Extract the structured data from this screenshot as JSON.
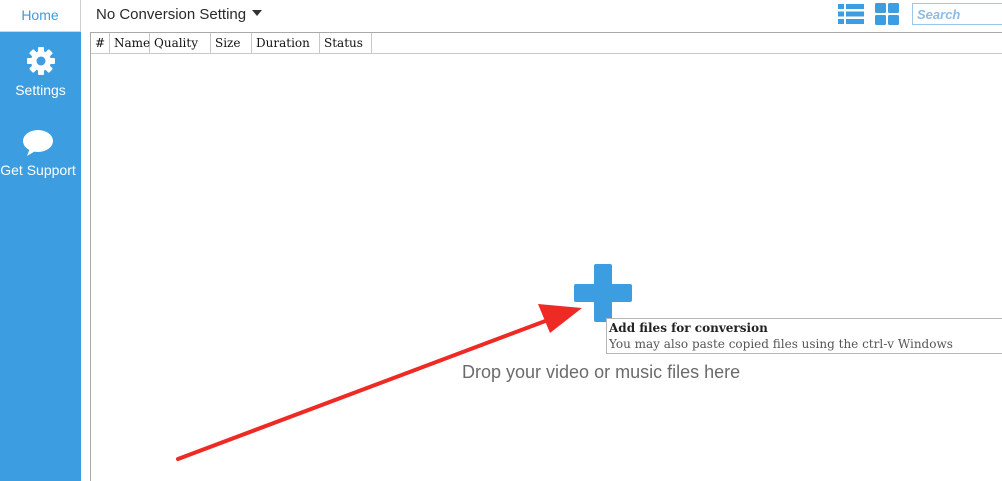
{
  "sidebar": {
    "home_label": "Home",
    "items": [
      {
        "label": "Settings",
        "icon": "gear-icon"
      },
      {
        "label": "Get Support",
        "icon": "speech-bubble-icon"
      }
    ]
  },
  "toolbar": {
    "conversion_setting": "No Conversion Setting",
    "search_placeholder": "Search",
    "view_icons": [
      "list-view-icon",
      "grid-view-icon"
    ]
  },
  "table": {
    "columns": [
      "#",
      "Name",
      "Quality",
      "Size",
      "Duration",
      "Status"
    ]
  },
  "dropzone": {
    "text": "Drop your video or music files here",
    "tooltip_title": "Add files for conversion",
    "tooltip_body": "You may also paste copied files using the ctrl-v Windows"
  },
  "colors": {
    "accent": "#3c9de0",
    "annotation_arrow": "#ee2a24"
  }
}
